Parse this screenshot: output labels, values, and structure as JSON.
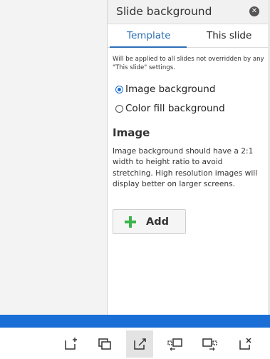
{
  "panel": {
    "title": "Slide background",
    "close_icon": "close-circle-icon",
    "tabs": [
      {
        "label": "Template",
        "active": true
      },
      {
        "label": "This slide",
        "active": false
      }
    ],
    "note": "Will be applied to all slides not overridden by any \"This slide\" settings.",
    "options": [
      {
        "label": "Image background",
        "checked": true
      },
      {
        "label": "Color fill background",
        "checked": false
      }
    ],
    "section_heading": "Image",
    "description": "Image background should have a 2:1 width to height ratio to avoid stretching. High resolution images will display better on larger screens.",
    "add_button": {
      "label": "Add",
      "icon": "plus-icon"
    }
  },
  "toolbar": {
    "buttons": [
      {
        "icon": "add-slide-icon",
        "active": false
      },
      {
        "icon": "duplicate-slide-icon",
        "active": false
      },
      {
        "icon": "slide-background-icon",
        "active": true
      },
      {
        "icon": "move-slide-left-icon",
        "active": false
      },
      {
        "icon": "move-slide-right-icon",
        "active": false
      },
      {
        "icon": "delete-slide-icon",
        "active": false
      }
    ]
  },
  "colors": {
    "accent": "#2c6fb7",
    "bottom_bar": "#1a6fd6",
    "add_plus": "#3bb54a"
  }
}
